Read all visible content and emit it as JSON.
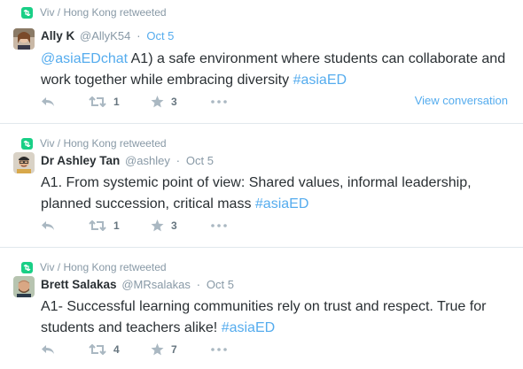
{
  "colors": {
    "link": "#55acee",
    "muted": "#8899a6",
    "retweet_green": "#19cf86",
    "divider": "#e1e8ed"
  },
  "tweets": [
    {
      "retweeted_by": "Viv / Hong Kong retweeted",
      "name": "Ally K",
      "handle": "@AllyK54",
      "time": "Oct 5",
      "text_parts": [
        "@asiaEDchat",
        " A1) a safe environment where students can collaborate and work together while embracing diversity ",
        "#asiaED"
      ],
      "retweets": "1",
      "favorites": "3",
      "view_conversation": "View conversation",
      "avatar_icon": "profile-photo-icon"
    },
    {
      "retweeted_by": "Viv / Hong Kong retweeted",
      "name": "Dr Ashley Tan",
      "handle": "@ashley",
      "time": "Oct 5",
      "text_parts": [
        "A1. From systemic point of view: Shared values, informal leadership, planned succession, critical mass ",
        "#asiaED"
      ],
      "retweets": "1",
      "favorites": "3",
      "avatar_icon": "profile-photo-icon"
    },
    {
      "retweeted_by": "Viv / Hong Kong retweeted",
      "name": "Brett Salakas",
      "handle": "@MRsalakas",
      "time": "Oct 5",
      "text_parts": [
        "A1- Successful learning communities rely on trust and respect. True for students and teachers alike! ",
        "#asiaED"
      ],
      "retweets": "4",
      "favorites": "7",
      "avatar_icon": "profile-photo-icon"
    }
  ],
  "icons": {
    "retweet_badge": "retweet-badge-icon",
    "reply": "reply-icon",
    "retweet": "retweet-icon",
    "favorite": "star-icon",
    "more": "more-icon"
  }
}
